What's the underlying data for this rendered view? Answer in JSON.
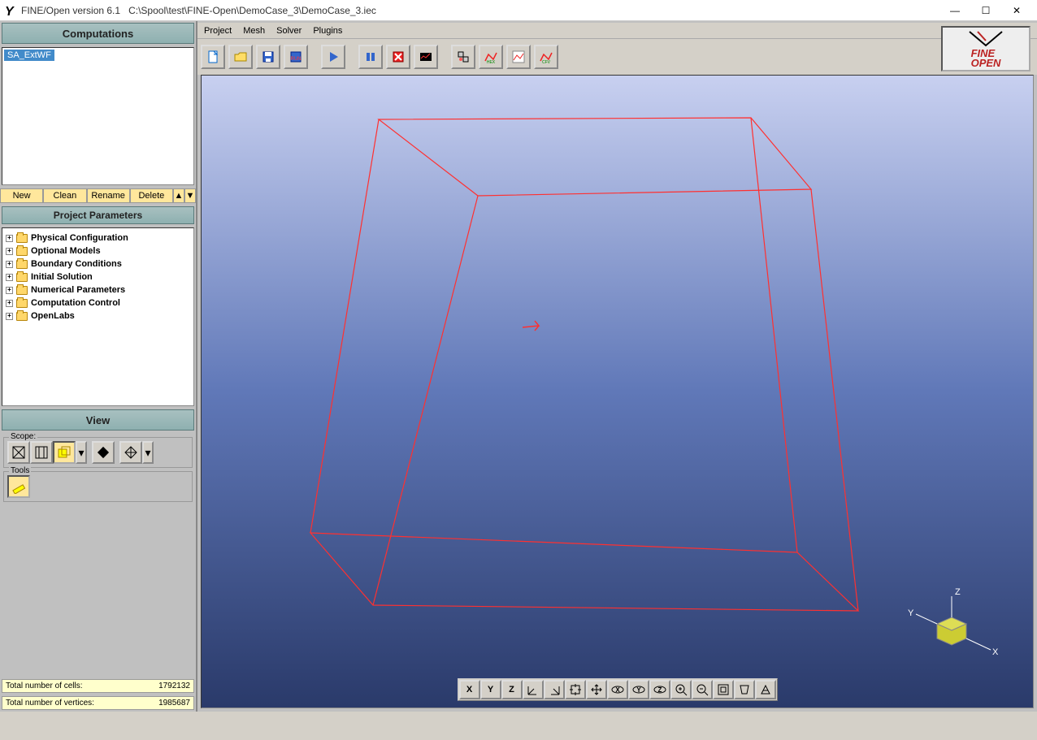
{
  "titlebar": {
    "app_name": "FINE/Open version 6.1",
    "file_path": "C:\\Spool\\test\\FINE-Open\\DemoCase_3\\DemoCase_3.iec"
  },
  "sidebar": {
    "computations_header": "Computations",
    "comp_items": [
      "SA_ExtWF"
    ],
    "buttons": {
      "new": "New",
      "clean": "Clean",
      "rename": "Rename",
      "delete": "Delete"
    },
    "params_header": "Project Parameters",
    "tree": [
      "Physical Configuration",
      "Optional Models",
      "Boundary Conditions",
      "Initial Solution",
      "Numerical Parameters",
      "Computation Control",
      "OpenLabs"
    ],
    "view_header": "View",
    "scope_label": "Scope:",
    "tools_label": "Tools"
  },
  "menubar": [
    "Project",
    "Mesh",
    "Solver",
    "Plugins"
  ],
  "logo": {
    "line1": "FINE",
    "line2": "OPEN"
  },
  "bottom_buttons": [
    "X",
    "Y",
    "Z"
  ],
  "axis_labels": {
    "x": "X",
    "y": "Y",
    "z": "Z"
  },
  "status": {
    "cells_label": "Total number of cells:",
    "cells_value": "1792132",
    "verts_label": "Total number of vertices:",
    "verts_value": "1985687"
  }
}
